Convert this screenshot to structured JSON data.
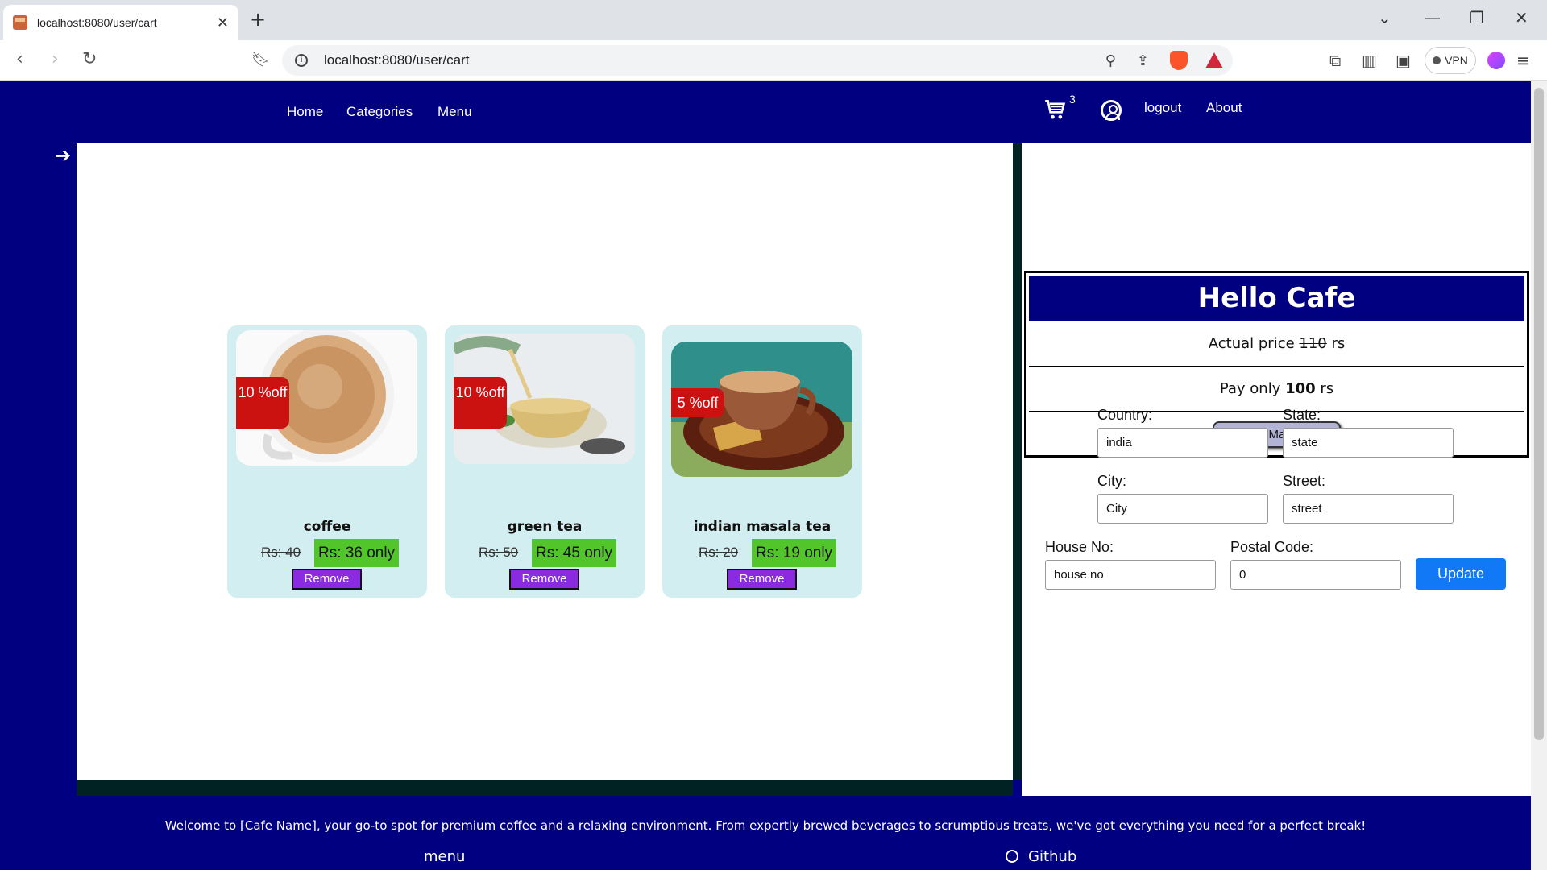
{
  "browser": {
    "tab_title": "localhost:8080/user/cart",
    "url": "localhost:8080/user/cart",
    "vpn_label": "VPN"
  },
  "nav": {
    "home": "Home",
    "categories": "Categories",
    "menu": "Menu",
    "cart_count": "3",
    "logout": "logout",
    "about": "About"
  },
  "cart_items": [
    {
      "name": "coffee",
      "discount": "10 %off",
      "old_price": "Rs: 40",
      "new_price": "Rs: 36 only",
      "remove": "Remove"
    },
    {
      "name": "green tea",
      "discount": "10 %off",
      "old_price": "Rs: 50",
      "new_price": "Rs: 45 only",
      "remove": "Remove"
    },
    {
      "name": "indian masala tea",
      "discount": "5 %off",
      "old_price": "Rs: 20",
      "new_price": "Rs: 19 only",
      "remove": "Remove"
    }
  ],
  "summary": {
    "title": "Hello Cafe",
    "actual_prefix": "Actual price ",
    "actual_value": "110",
    "actual_suffix": " rs",
    "pay_prefix": "Pay only ",
    "pay_value": "100",
    "pay_suffix": " rs",
    "button": "Pay and Make Order"
  },
  "address": {
    "country_label": "Country:",
    "country_value": "india",
    "state_label": "State:",
    "state_value": "state",
    "city_label": "City:",
    "city_value": "City",
    "street_label": "Street:",
    "street_value": "street",
    "house_label": "House No:",
    "house_value": "house no",
    "postal_label": "Postal Code:",
    "postal_value": "0",
    "update": "Update"
  },
  "footer": {
    "text": "Welcome to [Cafe Name], your go-to spot for premium coffee and a relaxing environment. From expertly brewed beverages to scrumptious treats, we've got everything you need for a perfect break!",
    "menu": "menu",
    "github": "Github"
  },
  "colors": {
    "navy": "#000080",
    "card_bg": "#d3eef0",
    "discount_badge": "#cc1111",
    "new_price_bg": "#51c52a",
    "remove_button": "#8a2be2",
    "update_button": "#1179f5"
  }
}
